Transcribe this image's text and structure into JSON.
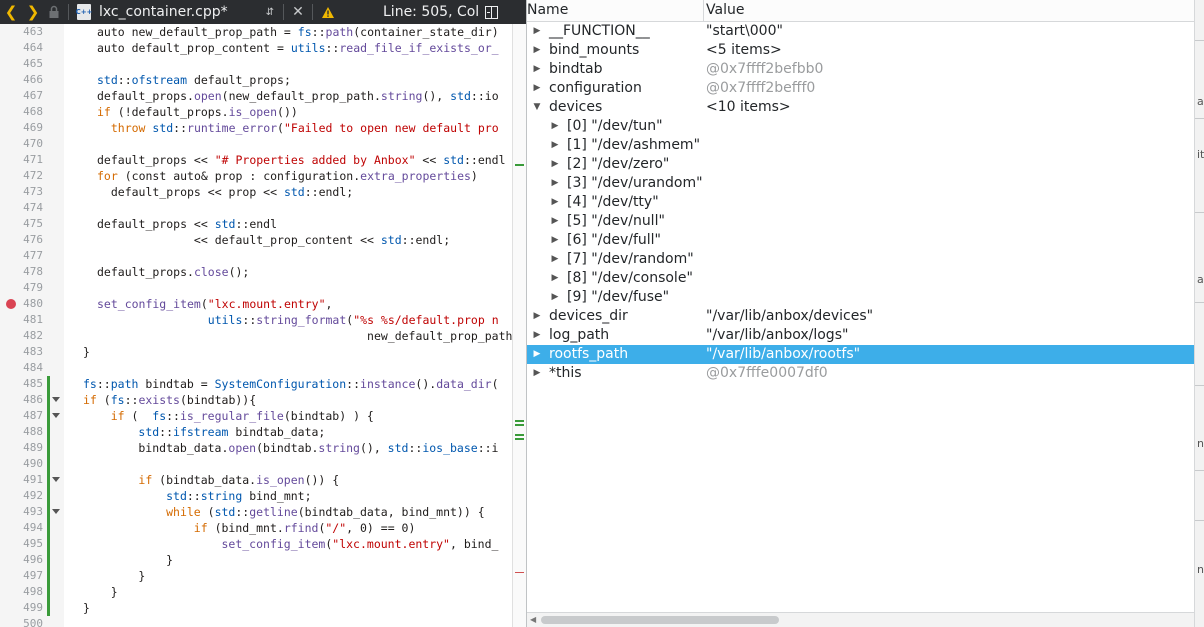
{
  "editor": {
    "toolbar": {
      "back_icon": "chevron-left-icon",
      "forward_icon": "chevron-right-icon",
      "file_name": "lxc_container.cpp*",
      "file_type_badge": "C++",
      "status": "Line: 505, Col"
    },
    "lines": [
      {
        "n": "463",
        "segs": [
          [
            "auto new_default_prop_path = ",
            ""
          ],
          [
            "fs",
            "tk-type"
          ],
          [
            "::",
            ""
          ],
          [
            "path",
            "tk-fn"
          ],
          [
            "(container_state_dir)",
            ""
          ]
        ],
        "indent": 1
      },
      {
        "n": "464",
        "segs": [
          [
            "auto default_prop_content = ",
            ""
          ],
          [
            "utils",
            "tk-type"
          ],
          [
            "::",
            ""
          ],
          [
            "read_file_if_exists_or_",
            "tk-fn"
          ]
        ],
        "indent": 1
      },
      {
        "n": "465",
        "segs": [],
        "indent": 0
      },
      {
        "n": "466",
        "segs": [
          [
            "std",
            "tk-type"
          ],
          [
            "::",
            ""
          ],
          [
            "ofstream",
            "tk-type"
          ],
          [
            " default_props;",
            ""
          ]
        ],
        "indent": 1
      },
      {
        "n": "467",
        "segs": [
          [
            "default_props.",
            ""
          ],
          [
            "open",
            "tk-fn"
          ],
          [
            "(new_default_prop_path.",
            ""
          ],
          [
            "string",
            "tk-fn"
          ],
          [
            "(), ",
            ""
          ],
          [
            "std",
            "tk-type"
          ],
          [
            "::io",
            ""
          ]
        ],
        "indent": 1
      },
      {
        "n": "468",
        "segs": [
          [
            "if",
            "tk-ctrl"
          ],
          [
            " (!default_props.",
            ""
          ],
          [
            "is_open",
            "tk-fn"
          ],
          [
            "())",
            ""
          ]
        ],
        "indent": 1
      },
      {
        "n": "469",
        "segs": [
          [
            "  throw ",
            "tk-ctrl"
          ],
          [
            "std",
            "tk-type"
          ],
          [
            "::",
            ""
          ],
          [
            "runtime_error",
            "tk-fn"
          ],
          [
            "(",
            ""
          ],
          [
            "\"Failed to open new default pro",
            "tk-str"
          ]
        ],
        "indent": 1
      },
      {
        "n": "470",
        "segs": [],
        "indent": 0
      },
      {
        "n": "471",
        "segs": [
          [
            "default_props << ",
            ""
          ],
          [
            "\"# Properties added by Anbox\"",
            "tk-str"
          ],
          [
            " << ",
            ""
          ],
          [
            "std",
            "tk-type"
          ],
          [
            "::endl",
            ""
          ]
        ],
        "indent": 1
      },
      {
        "n": "472",
        "segs": [
          [
            "for",
            "tk-ctrl"
          ],
          [
            " (",
            ""
          ],
          [
            "const",
            "tk-kw"
          ],
          [
            " auto& prop : configuration.",
            ""
          ],
          [
            "extra_properties",
            "tk-fn"
          ],
          [
            ")",
            ""
          ]
        ],
        "indent": 1
      },
      {
        "n": "473",
        "segs": [
          [
            "  default_props << prop << ",
            ""
          ],
          [
            "std",
            "tk-type"
          ],
          [
            "::endl;",
            ""
          ]
        ],
        "indent": 1
      },
      {
        "n": "474",
        "segs": [],
        "indent": 0
      },
      {
        "n": "475",
        "segs": [
          [
            "default_props << ",
            ""
          ],
          [
            "std",
            "tk-type"
          ],
          [
            "::endl",
            ""
          ]
        ],
        "indent": 1
      },
      {
        "n": "476",
        "segs": [
          [
            "              << default_prop_content << ",
            ""
          ],
          [
            "std",
            "tk-type"
          ],
          [
            "::endl;",
            ""
          ]
        ],
        "indent": 1
      },
      {
        "n": "477",
        "segs": [],
        "indent": 0
      },
      {
        "n": "478",
        "segs": [
          [
            "default_props.",
            ""
          ],
          [
            "close",
            "tk-fn"
          ],
          [
            "();",
            ""
          ]
        ],
        "indent": 1
      },
      {
        "n": "479",
        "segs": [],
        "indent": 0
      },
      {
        "n": "480",
        "segs": [
          [
            "set_config_item",
            "tk-fn"
          ],
          [
            "(",
            ""
          ],
          [
            "\"lxc.mount.entry\"",
            "tk-str"
          ],
          [
            ",",
            ""
          ]
        ],
        "indent": 1,
        "breakpoint": true
      },
      {
        "n": "481",
        "segs": [
          [
            "                ",
            ""
          ],
          [
            "utils",
            "tk-type"
          ],
          [
            "::",
            ""
          ],
          [
            "string_format",
            "tk-fn"
          ],
          [
            "(",
            ""
          ],
          [
            "\"%s %s/default.prop n",
            "tk-str"
          ]
        ],
        "indent": 1
      },
      {
        "n": "482",
        "segs": [
          [
            "                                       new_default_prop_path",
            ""
          ]
        ],
        "indent": 1
      },
      {
        "n": "483",
        "segs": [
          [
            "}",
            ""
          ]
        ],
        "indent": 0
      },
      {
        "n": "484",
        "segs": [],
        "indent": 0
      },
      {
        "n": "485",
        "segs": [
          [
            "fs",
            "tk-type"
          ],
          [
            "::",
            ""
          ],
          [
            "path",
            "tk-type"
          ],
          [
            " bindtab = ",
            ""
          ],
          [
            "SystemConfiguration",
            "tk-type"
          ],
          [
            "::",
            ""
          ],
          [
            "instance",
            "tk-fn"
          ],
          [
            "().",
            ""
          ],
          [
            "data_dir",
            "tk-fn"
          ],
          [
            "(",
            ""
          ]
        ],
        "indent": 0,
        "mod": true
      },
      {
        "n": "486",
        "segs": [
          [
            "if",
            "tk-ctrl"
          ],
          [
            " (",
            ""
          ],
          [
            "fs",
            "tk-type"
          ],
          [
            "::",
            ""
          ],
          [
            "exists",
            "tk-fn"
          ],
          [
            "(bindtab)){",
            ""
          ]
        ],
        "indent": 0,
        "mod": true,
        "fold": true
      },
      {
        "n": "487",
        "segs": [
          [
            "    ",
            ""
          ],
          [
            "if",
            "tk-ctrl"
          ],
          [
            " (  ",
            ""
          ],
          [
            "fs",
            "tk-type"
          ],
          [
            "::",
            ""
          ],
          [
            "is_regular_file",
            "tk-fn"
          ],
          [
            "(bindtab) ) {",
            ""
          ]
        ],
        "indent": 0,
        "mod": true,
        "fold": true
      },
      {
        "n": "488",
        "segs": [
          [
            "        ",
            ""
          ],
          [
            "std",
            "tk-type"
          ],
          [
            "::",
            ""
          ],
          [
            "ifstream",
            "tk-type"
          ],
          [
            " bindtab_data;",
            ""
          ]
        ],
        "indent": 0,
        "mod": true
      },
      {
        "n": "489",
        "segs": [
          [
            "        bindtab_data.",
            ""
          ],
          [
            "open",
            "tk-fn"
          ],
          [
            "(bindtab.",
            ""
          ],
          [
            "string",
            "tk-fn"
          ],
          [
            "(), ",
            ""
          ],
          [
            "std",
            "tk-type"
          ],
          [
            "::",
            ""
          ],
          [
            "ios_base",
            "tk-type"
          ],
          [
            "::i",
            ""
          ]
        ],
        "indent": 0,
        "mod": true
      },
      {
        "n": "490",
        "segs": [],
        "indent": 0,
        "mod": true
      },
      {
        "n": "491",
        "segs": [
          [
            "        ",
            ""
          ],
          [
            "if",
            "tk-ctrl"
          ],
          [
            " (bindtab_data.",
            ""
          ],
          [
            "is_open",
            "tk-fn"
          ],
          [
            "()) {",
            ""
          ]
        ],
        "indent": 0,
        "mod": true,
        "fold": true
      },
      {
        "n": "492",
        "segs": [
          [
            "            ",
            ""
          ],
          [
            "std",
            "tk-type"
          ],
          [
            "::",
            ""
          ],
          [
            "string",
            "tk-type"
          ],
          [
            " bind_mnt;",
            ""
          ]
        ],
        "indent": 0,
        "mod": true
      },
      {
        "n": "493",
        "segs": [
          [
            "            ",
            ""
          ],
          [
            "while",
            "tk-ctrl"
          ],
          [
            " (",
            ""
          ],
          [
            "std",
            "tk-type"
          ],
          [
            "::",
            ""
          ],
          [
            "getline",
            "tk-fn"
          ],
          [
            "(bindtab_data, bind_mnt)) {",
            ""
          ]
        ],
        "indent": 0,
        "mod": true,
        "fold": true
      },
      {
        "n": "494",
        "segs": [
          [
            "                ",
            ""
          ],
          [
            "if",
            "tk-ctrl"
          ],
          [
            " (bind_mnt.",
            ""
          ],
          [
            "rfind",
            "tk-fn"
          ],
          [
            "(",
            ""
          ],
          [
            "\"/\"",
            "tk-str"
          ],
          [
            ", 0) == 0)",
            ""
          ]
        ],
        "indent": 0,
        "mod": true
      },
      {
        "n": "495",
        "segs": [
          [
            "                    ",
            ""
          ],
          [
            "set_config_item",
            "tk-fn"
          ],
          [
            "(",
            ""
          ],
          [
            "\"lxc.mount.entry\"",
            "tk-str"
          ],
          [
            ", bind_",
            ""
          ]
        ],
        "indent": 0,
        "mod": true
      },
      {
        "n": "496",
        "segs": [
          [
            "            }",
            ""
          ]
        ],
        "indent": 0,
        "mod": true
      },
      {
        "n": "497",
        "segs": [
          [
            "        }",
            ""
          ]
        ],
        "indent": 0,
        "mod": true
      },
      {
        "n": "498",
        "segs": [
          [
            "    }",
            ""
          ]
        ],
        "indent": 0,
        "mod": true
      },
      {
        "n": "499",
        "segs": [
          [
            "}",
            ""
          ]
        ],
        "indent": 0,
        "mod": true
      },
      {
        "n": "500",
        "segs": [],
        "indent": 0
      }
    ]
  },
  "locals": {
    "header": {
      "name": "Name",
      "value": "Value"
    },
    "rows": [
      {
        "depth": 0,
        "arrow": "right",
        "name": "__FUNCTION__",
        "value": "\"start\\000\"",
        "dim": false
      },
      {
        "depth": 0,
        "arrow": "right",
        "name": "bind_mounts",
        "value": "<5 items>",
        "dim": false
      },
      {
        "depth": 0,
        "arrow": "right",
        "name": "bindtab",
        "value": "@0x7ffff2befbb0",
        "dim": true
      },
      {
        "depth": 0,
        "arrow": "right",
        "name": "configuration",
        "value": "@0x7ffff2befff0",
        "dim": true
      },
      {
        "depth": 0,
        "arrow": "down",
        "name": "devices",
        "value": "<10 items>",
        "dim": false
      },
      {
        "depth": 1,
        "arrow": "right",
        "name": "[0] \"/dev/tun\"",
        "value": "",
        "dim": false
      },
      {
        "depth": 1,
        "arrow": "right",
        "name": "[1] \"/dev/ashmem\"",
        "value": "",
        "dim": false
      },
      {
        "depth": 1,
        "arrow": "right",
        "name": "[2] \"/dev/zero\"",
        "value": "",
        "dim": false
      },
      {
        "depth": 1,
        "arrow": "right",
        "name": "[3] \"/dev/urandom\"",
        "value": "",
        "dim": false
      },
      {
        "depth": 1,
        "arrow": "right",
        "name": "[4] \"/dev/tty\"",
        "value": "",
        "dim": false
      },
      {
        "depth": 1,
        "arrow": "right",
        "name": "[5] \"/dev/null\"",
        "value": "",
        "dim": false
      },
      {
        "depth": 1,
        "arrow": "right",
        "name": "[6] \"/dev/full\"",
        "value": "",
        "dim": false
      },
      {
        "depth": 1,
        "arrow": "right",
        "name": "[7] \"/dev/random\"",
        "value": "",
        "dim": false
      },
      {
        "depth": 1,
        "arrow": "right",
        "name": "[8] \"/dev/console\"",
        "value": "",
        "dim": false
      },
      {
        "depth": 1,
        "arrow": "right",
        "name": "[9] \"/dev/fuse\"",
        "value": "",
        "dim": false
      },
      {
        "depth": 0,
        "arrow": "right",
        "name": "devices_dir",
        "value": "\"/var/lib/anbox/devices\"",
        "dim": false
      },
      {
        "depth": 0,
        "arrow": "right",
        "name": "log_path",
        "value": "\"/var/lib/anbox/logs\"",
        "dim": false
      },
      {
        "depth": 0,
        "arrow": "right",
        "name": "rootfs_path",
        "value": "\"/var/lib/anbox/rootfs\"",
        "dim": false,
        "selected": true
      },
      {
        "depth": 0,
        "arrow": "right",
        "name": "*this",
        "value": "@0x7fffe0007df0",
        "dim": true
      }
    ]
  },
  "right_strip": {
    "labels": [
      "ab",
      "ith",
      "av",
      "ni",
      "n"
    ]
  },
  "colors": {
    "selection": "#3daee9",
    "breakpoint": "#da4453",
    "modified": "#3a9b3a",
    "toolbar_bg": "#2b2d30",
    "arrow_accent": "#f0b800"
  }
}
